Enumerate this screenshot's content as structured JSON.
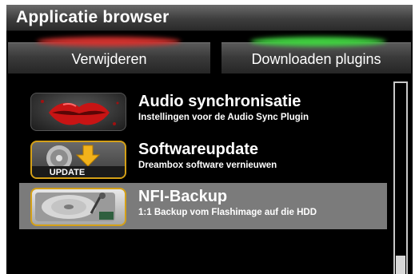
{
  "window": {
    "title": "Applicatie browser"
  },
  "buttons": {
    "red_label": "Verwijderen",
    "green_label": "Downloaden plugins"
  },
  "colors": {
    "red_key": "#d0312d",
    "green_key": "#3fcf3f",
    "selection": "#7b7b7b"
  },
  "plugins": [
    {
      "title": "Audio synchronisatie",
      "description": "Instellingen voor de Audio Sync Plugin",
      "icon": "lips-icon",
      "selected": false
    },
    {
      "title": "Softwareupdate",
      "description": "Dreambox software vernieuwen",
      "icon": "update-icon",
      "icon_label": "UPDATE",
      "selected": false
    },
    {
      "title": "NFI-Backup",
      "description": "1:1 Backup vom Flashimage auf die HDD",
      "icon": "hard-disk-icon",
      "selected": true
    }
  ]
}
